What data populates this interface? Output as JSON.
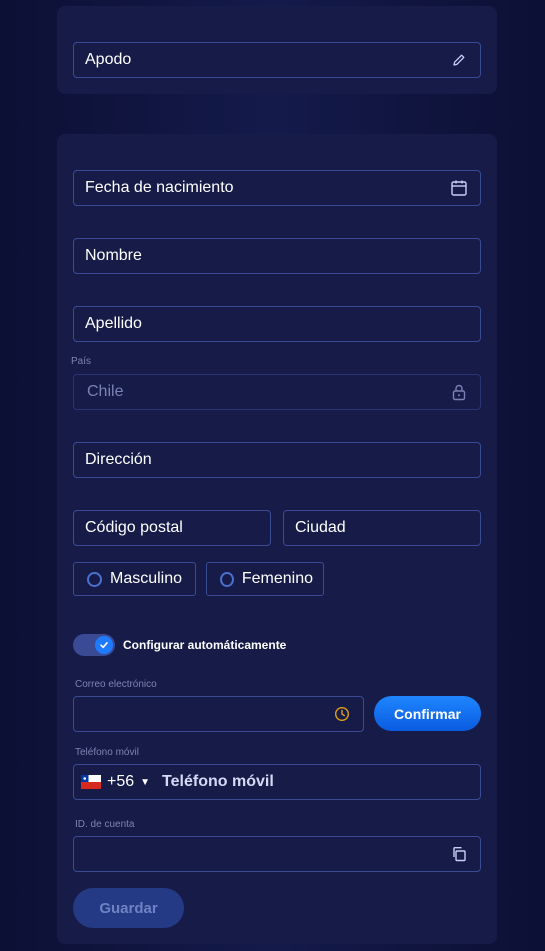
{
  "nickname": {
    "label": "Apodo",
    "icon": "pencil-icon"
  },
  "form": {
    "birthdate": {
      "label": "Fecha de nacimiento",
      "icon": "calendar-icon"
    },
    "first_name": {
      "label": "Nombre"
    },
    "last_name": {
      "label": "Apellido"
    },
    "country": {
      "caption": "País",
      "value": "Chile",
      "icon": "lock-icon"
    },
    "address": {
      "label": "Dirección"
    },
    "postal_code": {
      "label": "Código postal"
    },
    "city": {
      "label": "Ciudad"
    },
    "gender": {
      "options": [
        "Masculino",
        "Femenino"
      ]
    },
    "auto_config": {
      "label": "Configurar automáticamente",
      "enabled": true
    },
    "email": {
      "caption": "Correo electrónico",
      "value": "",
      "icon": "clock-icon",
      "confirm_label": "Confirmar"
    },
    "phone": {
      "caption": "Teléfono móvil",
      "country_code": "+56",
      "placeholder": "Teléfono móvil",
      "flag": "chile-flag-icon"
    },
    "account_id": {
      "caption": "ID. de cuenta",
      "value": "",
      "icon": "copy-icon"
    },
    "save_label": "Guardar"
  },
  "colors": {
    "background": "#0f1440",
    "card": "#161c47",
    "border": "#3a4a94",
    "accent": "#1e7bff",
    "warning_icon": "#e0a11a"
  }
}
